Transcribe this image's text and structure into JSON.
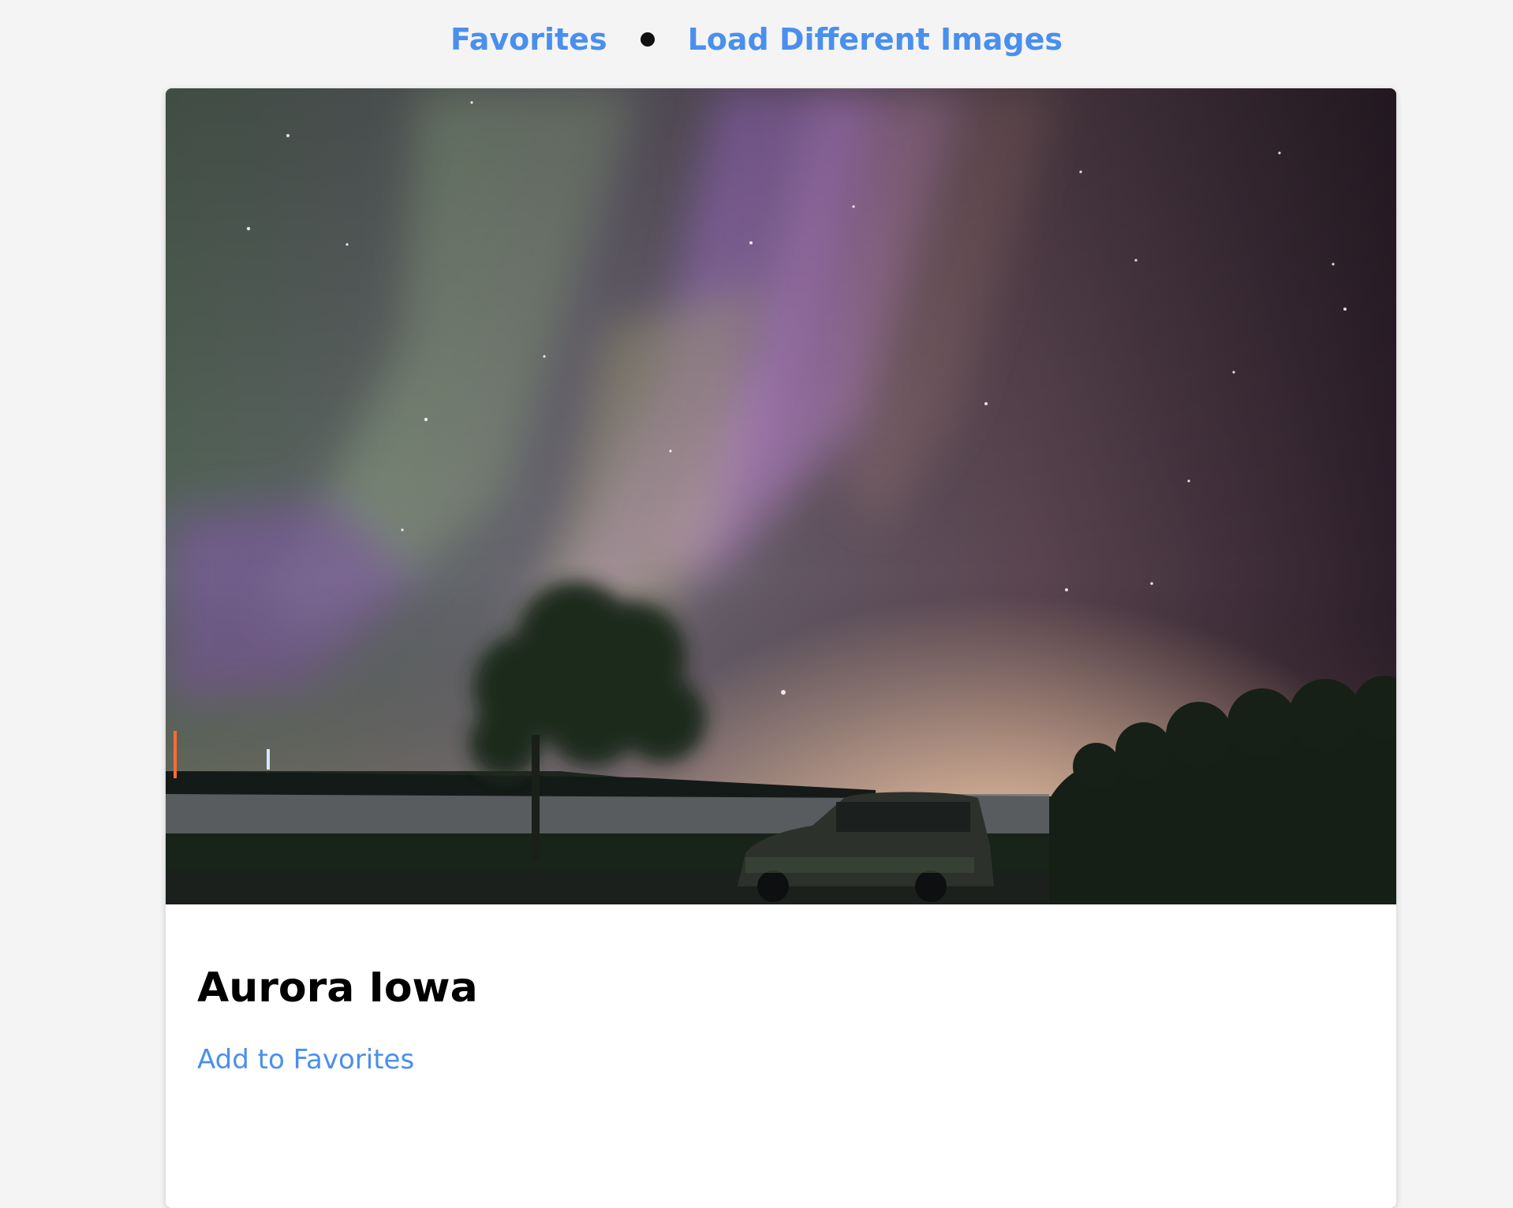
{
  "nav": {
    "favorites_label": "Favorites",
    "load_label": "Load Different Images"
  },
  "card": {
    "image_alt": "Aurora Iowa",
    "title": "Aurora Iowa",
    "add_favorite_label": "Add to Favorites"
  },
  "colors": {
    "link": "#4a8fec",
    "background": "#f4f4f4",
    "card": "#ffffff"
  }
}
